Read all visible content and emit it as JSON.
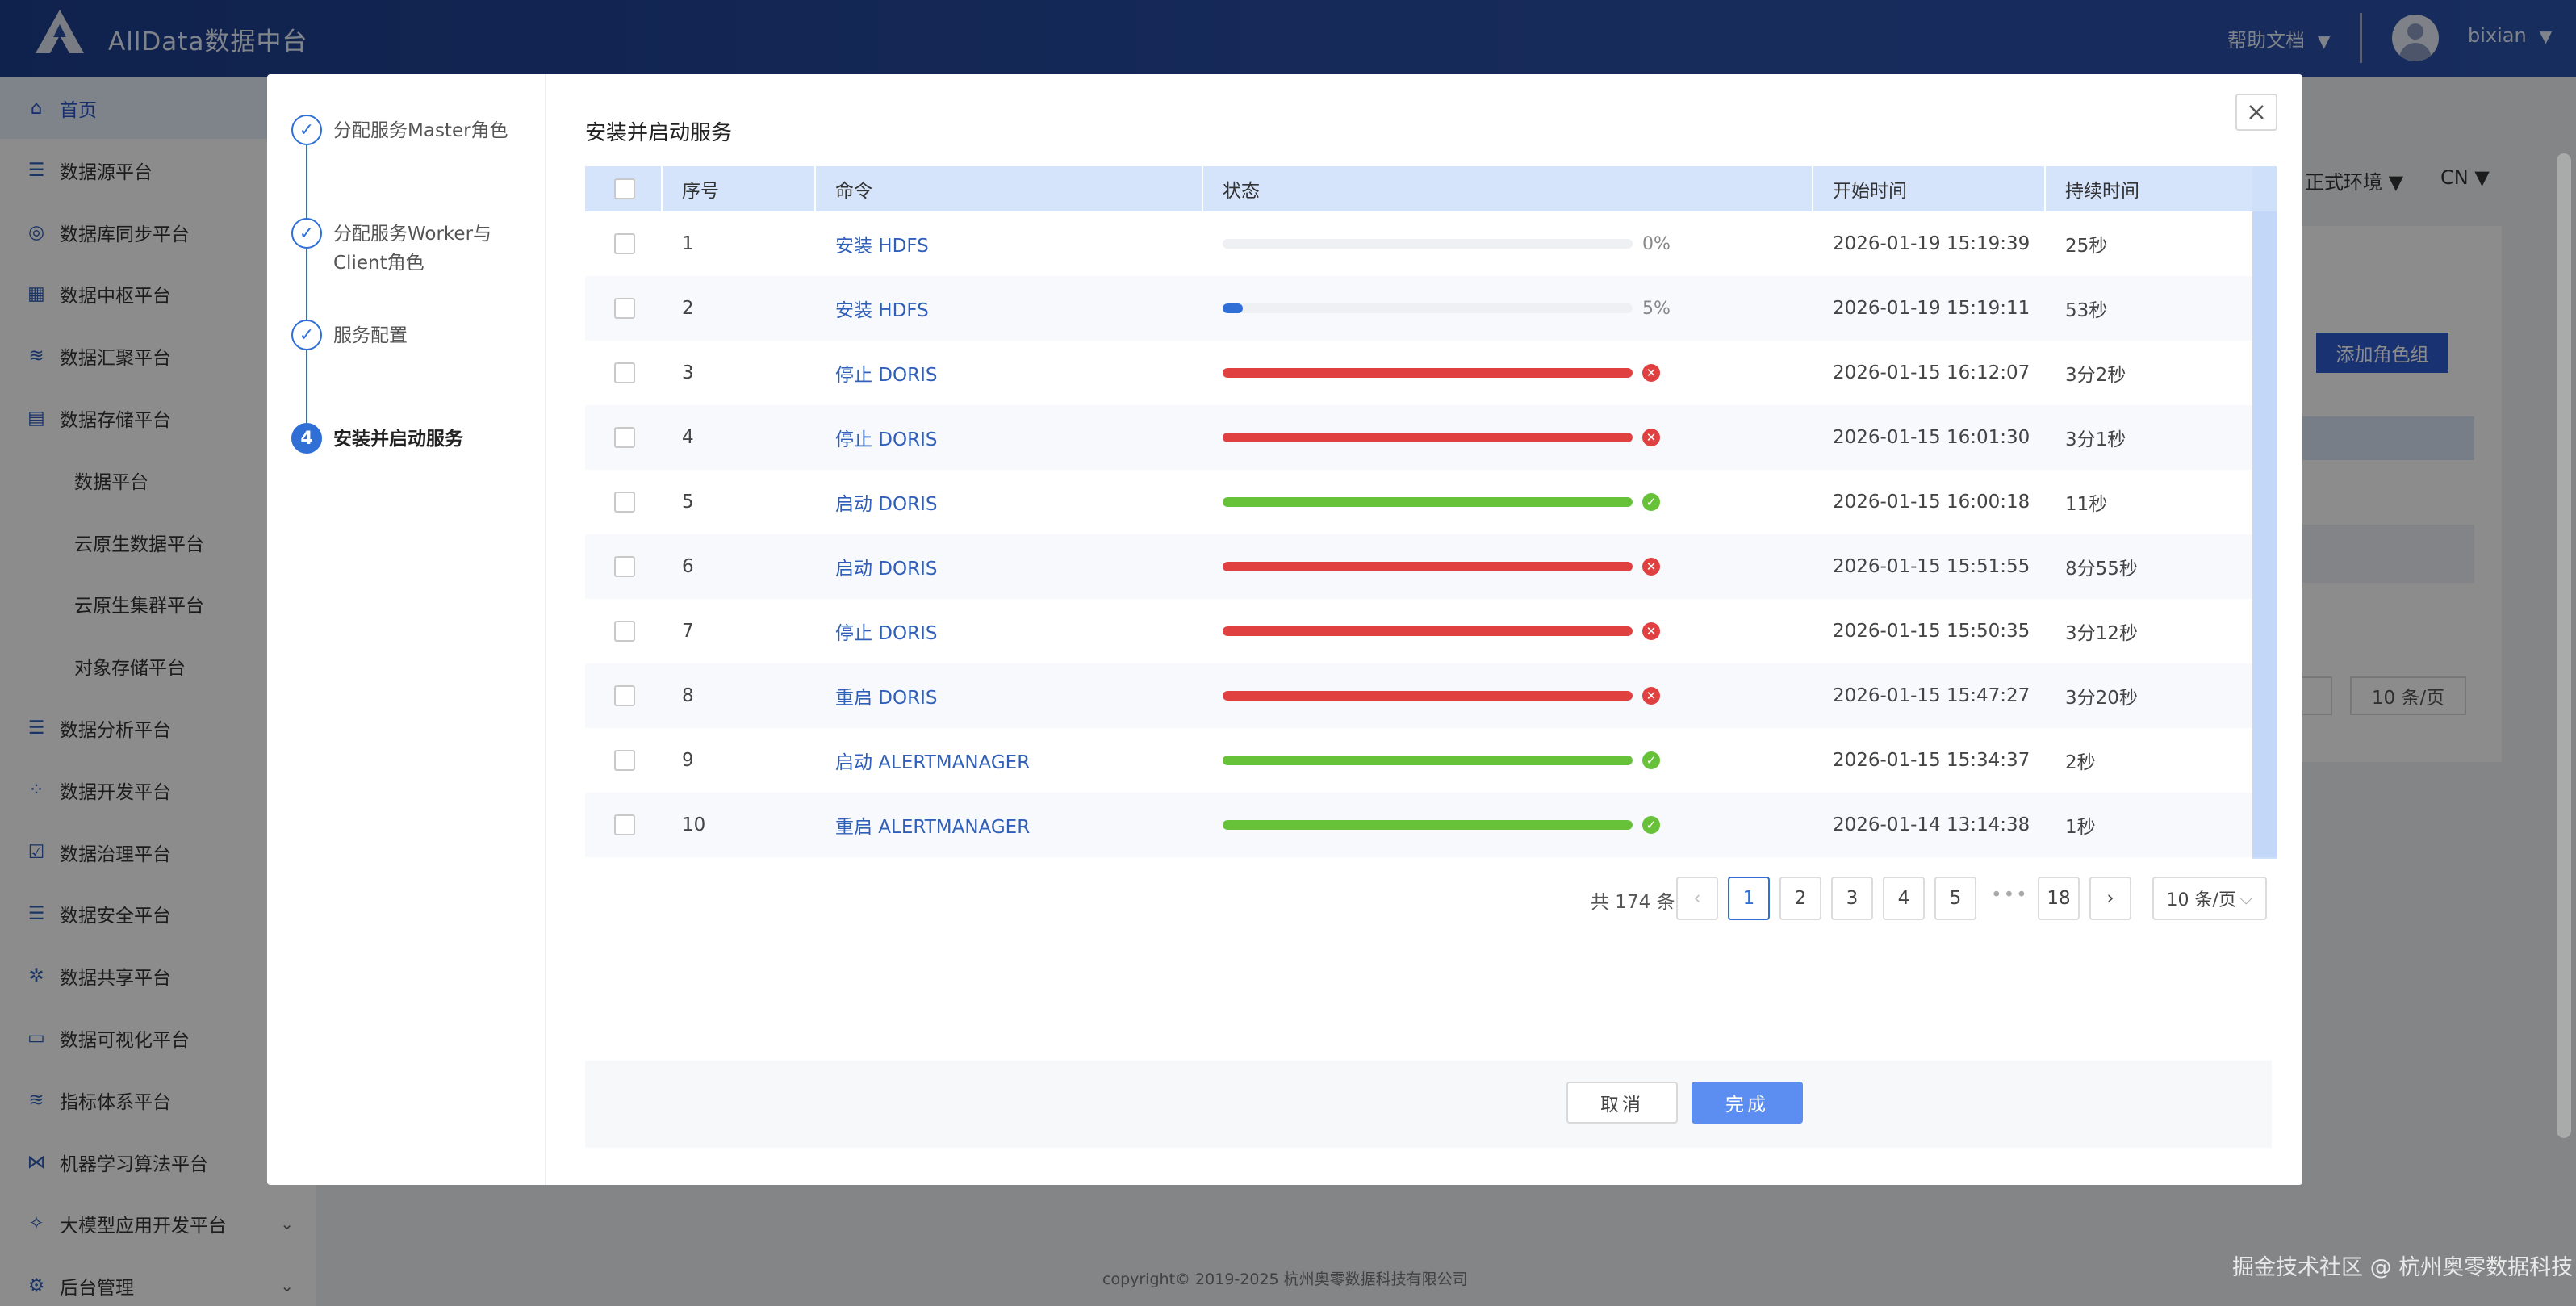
{
  "app": {
    "title": "AllData数据中台",
    "help_label": "帮助文档",
    "username": "bixian"
  },
  "sidebar": {
    "items": [
      {
        "label": "首页",
        "icon": "home-icon",
        "active": true
      },
      {
        "label": "数据源平台",
        "icon": "database-icon"
      },
      {
        "label": "数据库同步平台",
        "icon": "sync-icon"
      },
      {
        "label": "数据中枢平台",
        "icon": "grid-icon"
      },
      {
        "label": "数据汇聚平台",
        "icon": "layers-icon"
      },
      {
        "label": "数据存储平台",
        "icon": "storage-icon"
      },
      {
        "label": "数据平台",
        "sub": true
      },
      {
        "label": "云原生数据平台",
        "sub": true
      },
      {
        "label": "云原生集群平台",
        "sub": true
      },
      {
        "label": "对象存储平台",
        "sub": true
      },
      {
        "label": "数据分析平台",
        "icon": "database-icon"
      },
      {
        "label": "数据开发平台",
        "icon": "apps-icon"
      },
      {
        "label": "数据治理平台",
        "icon": "checklist-icon"
      },
      {
        "label": "数据安全平台",
        "icon": "database-icon"
      },
      {
        "label": "数据共享平台",
        "icon": "share-icon"
      },
      {
        "label": "数据可视化平台",
        "icon": "monitor-icon"
      },
      {
        "label": "指标体系平台",
        "icon": "layers-icon"
      },
      {
        "label": "机器学习算法平台",
        "icon": "network-icon"
      },
      {
        "label": "大模型应用开发平台",
        "icon": "model-icon",
        "caret": true
      },
      {
        "label": "后台管理",
        "icon": "settings-icon",
        "caret": true
      }
    ]
  },
  "background": {
    "env_label": "正式环境",
    "lang_label": "CN",
    "add_group_label": "添加角色组",
    "page_size_label": "10 条/页"
  },
  "footer": {
    "copyright": "copyright© 2019-2025 杭州奥零数据科技有限公司"
  },
  "watermark": "掘金技术社区 @ 杭州奥零数据科技",
  "modal": {
    "title": "安装并启动服务",
    "steps": [
      {
        "label": "分配服务Master角色",
        "state": "done"
      },
      {
        "label": "分配服务Worker与Client角色",
        "state": "done"
      },
      {
        "label": "服务配置",
        "state": "done"
      },
      {
        "label": "安装并启动服务",
        "state": "current",
        "index": "4"
      }
    ],
    "table": {
      "columns": [
        "序号",
        "命令",
        "状态",
        "开始时间",
        "持续时间"
      ],
      "rows": [
        {
          "index": "1",
          "command": "安装 HDFS",
          "progress": 0,
          "status": "running",
          "pct_label": "0%",
          "start": "2026-01-19 15:19:39",
          "duration": "25秒"
        },
        {
          "index": "2",
          "command": "安装 HDFS",
          "progress": 5,
          "status": "running",
          "pct_label": "5%",
          "start": "2026-01-19 15:19:11",
          "duration": "53秒"
        },
        {
          "index": "3",
          "command": "停止 DORIS",
          "progress": 100,
          "status": "failed",
          "start": "2026-01-15 16:12:07",
          "duration": "3分2秒"
        },
        {
          "index": "4",
          "command": "停止 DORIS",
          "progress": 100,
          "status": "failed",
          "start": "2026-01-15 16:01:30",
          "duration": "3分1秒"
        },
        {
          "index": "5",
          "command": "启动 DORIS",
          "progress": 100,
          "status": "success",
          "start": "2026-01-15 16:00:18",
          "duration": "11秒"
        },
        {
          "index": "6",
          "command": "启动 DORIS",
          "progress": 100,
          "status": "failed",
          "start": "2026-01-15 15:51:55",
          "duration": "8分55秒"
        },
        {
          "index": "7",
          "command": "停止 DORIS",
          "progress": 100,
          "status": "failed",
          "start": "2026-01-15 15:50:35",
          "duration": "3分12秒"
        },
        {
          "index": "8",
          "command": "重启 DORIS",
          "progress": 100,
          "status": "failed",
          "start": "2026-01-15 15:47:27",
          "duration": "3分20秒"
        },
        {
          "index": "9",
          "command": "启动 ALERTMANAGER",
          "progress": 100,
          "status": "success",
          "start": "2026-01-15 15:34:37",
          "duration": "2秒"
        },
        {
          "index": "10",
          "command": "重启 ALERTMANAGER",
          "progress": 100,
          "status": "success",
          "start": "2026-01-14 13:14:38",
          "duration": "1秒"
        }
      ]
    },
    "pagination": {
      "total_label": "共 174 条",
      "pages": [
        "1",
        "2",
        "3",
        "4",
        "5"
      ],
      "ellipsis": "•••",
      "last_page": "18",
      "current": "1",
      "page_size": "10 条/页"
    },
    "buttons": {
      "cancel": "取消",
      "done": "完成"
    }
  },
  "colors": {
    "brand": "#2a4fa6",
    "accent": "#2f6fd6",
    "success": "#67c23a",
    "failed": "#e04040",
    "running": "#2f6fd6"
  }
}
